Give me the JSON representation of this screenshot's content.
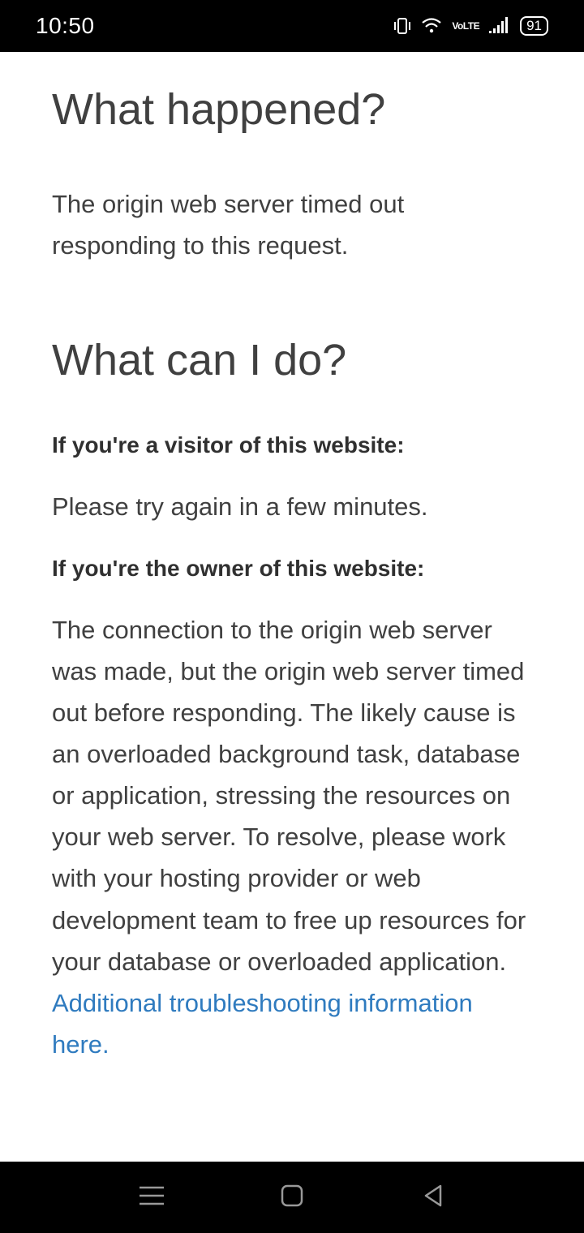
{
  "statusBar": {
    "time": "10:50",
    "battery": "91",
    "volte_line1": "Vo",
    "volte_line2": "LTE"
  },
  "content": {
    "heading1": "What happened?",
    "paragraph1": "The origin web server timed out responding to this request.",
    "heading2": "What can I do?",
    "subheading1": "If you're a visitor of this website:",
    "paragraph2": "Please try again in a few minutes.",
    "subheading2": "If you're the owner of this website:",
    "paragraph3": "The connection to the origin web server was made, but the origin web server timed out before responding. The likely cause is an overloaded background task, database or application, stressing the resources on your web server. To resolve, please work with your hosting provider or web development team to free up resources for your database or overloaded application. ",
    "linkText": "Additional troubleshooting information here."
  }
}
